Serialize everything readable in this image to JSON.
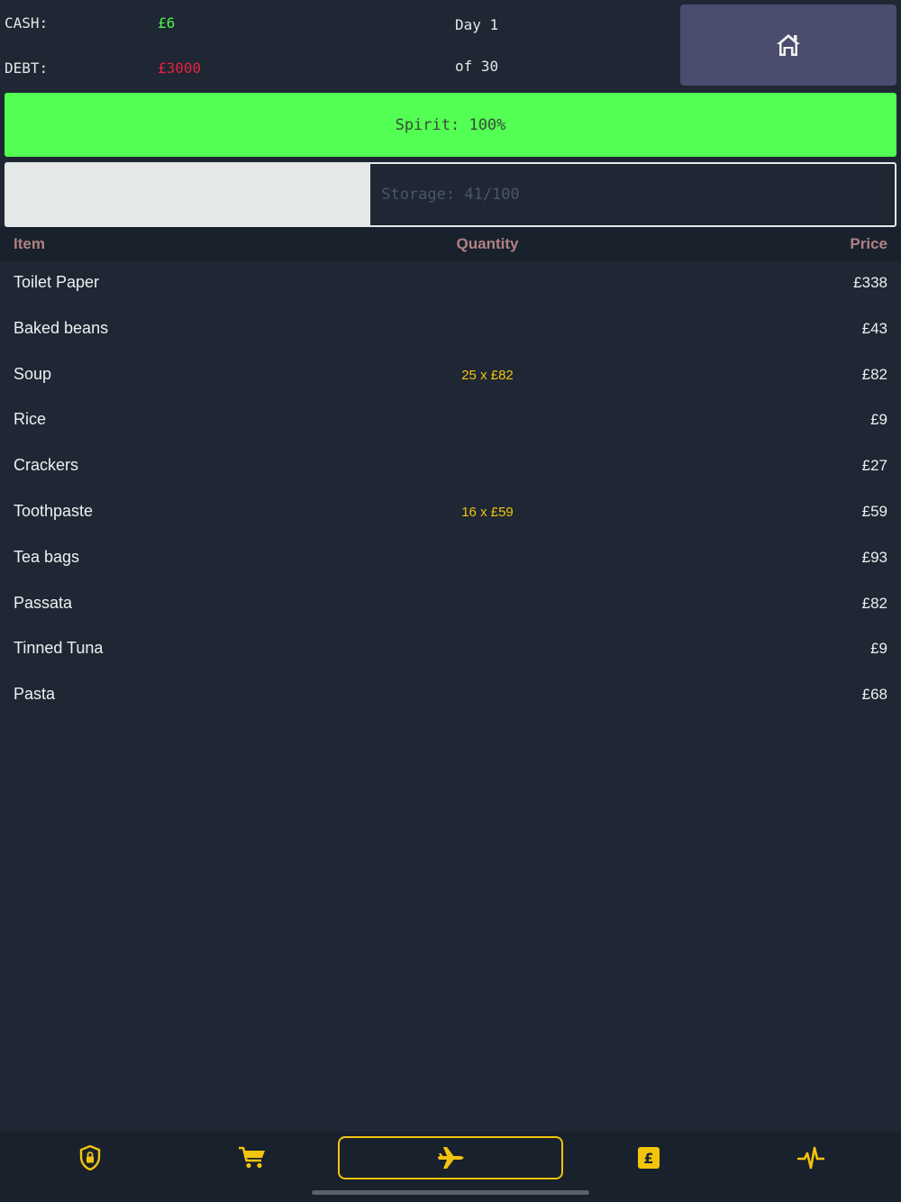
{
  "header": {
    "cash_label": "CASH:",
    "cash_value": "£6",
    "debt_label": "DEBT:",
    "debt_value": "£3000",
    "day_line1": "Day 1",
    "day_line2": "of 30",
    "home_icon": "home-icon"
  },
  "spirit": {
    "label": "Spirit: 100%",
    "percent": 100,
    "color": "#52ff52"
  },
  "storage": {
    "label": "Storage: 41/100",
    "used": 41,
    "capacity": 100
  },
  "colors": {
    "cash": "#4cf04c",
    "debt": "#e8213f",
    "accent": "#f2c40e",
    "header_text": "#b08283"
  },
  "table": {
    "headers": {
      "item": "Item",
      "quantity": "Quantity",
      "price": "Price"
    },
    "rows": [
      {
        "item": "Toilet Paper",
        "quantity": "",
        "price": "£338"
      },
      {
        "item": "Baked beans",
        "quantity": "",
        "price": "£43"
      },
      {
        "item": "Soup",
        "quantity": "25 x £82",
        "price": "£82"
      },
      {
        "item": "Rice",
        "quantity": "",
        "price": "£9"
      },
      {
        "item": "Crackers",
        "quantity": "",
        "price": "£27"
      },
      {
        "item": "Toothpaste",
        "quantity": "16 x £59",
        "price": "£59"
      },
      {
        "item": "Tea bags",
        "quantity": "",
        "price": "£93"
      },
      {
        "item": "Passata",
        "quantity": "",
        "price": "£82"
      },
      {
        "item": "Tinned Tuna",
        "quantity": "",
        "price": "£9"
      },
      {
        "item": "Pasta",
        "quantity": "",
        "price": "£68"
      }
    ]
  },
  "nav": {
    "items": [
      {
        "icon": "shield-lock-icon",
        "active": false
      },
      {
        "icon": "shopping-cart-icon",
        "active": false
      },
      {
        "icon": "airplane-icon",
        "active": true
      },
      {
        "icon": "pound-icon",
        "active": false
      },
      {
        "icon": "pulse-icon",
        "active": false
      }
    ]
  }
}
